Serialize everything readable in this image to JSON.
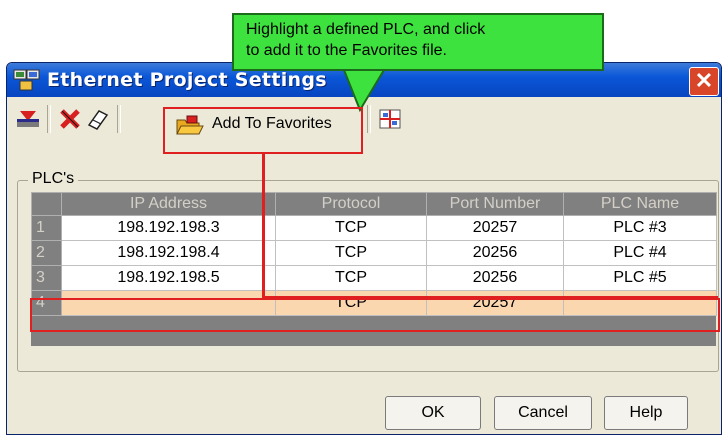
{
  "callout": {
    "text": "Highlight  a defined PLC, and  click\nto add it to the Favorites file."
  },
  "window": {
    "title": "Ethernet Project Settings",
    "close_glyph": "✕"
  },
  "toolbar": {
    "add_to_favorites_label": "Add To Favorites"
  },
  "group": {
    "label": "PLC's"
  },
  "table": {
    "columns": [
      "",
      "IP Address",
      "Protocol",
      "Port Number",
      "PLC Name"
    ],
    "rows": [
      {
        "num": "1",
        "ip": "198.192.198.3",
        "protocol": "TCP",
        "port": "20257",
        "name": "PLC #3"
      },
      {
        "num": "2",
        "ip": "198.192.198.4",
        "protocol": "TCP",
        "port": "20256",
        "name": "PLC #4"
      },
      {
        "num": "3",
        "ip": "198.192.198.5",
        "protocol": "TCP",
        "port": "20256",
        "name": "PLC #5"
      },
      {
        "num": "4",
        "ip": "",
        "protocol": "TCP",
        "port": "20257",
        "name": ""
      }
    ],
    "selected_row": 4
  },
  "buttons": {
    "ok": "OK",
    "cancel": "Cancel",
    "help": "Help"
  },
  "colors": {
    "highlight": "#e02020",
    "callout": "#3ee23e",
    "selected_row": "#fbd7b0",
    "title_bar": "#0a57d8"
  },
  "icons": [
    "app-icon",
    "download-icon",
    "delete-icon",
    "eraser-icon",
    "folder-open-icon",
    "network-icon",
    "close-icon"
  ]
}
